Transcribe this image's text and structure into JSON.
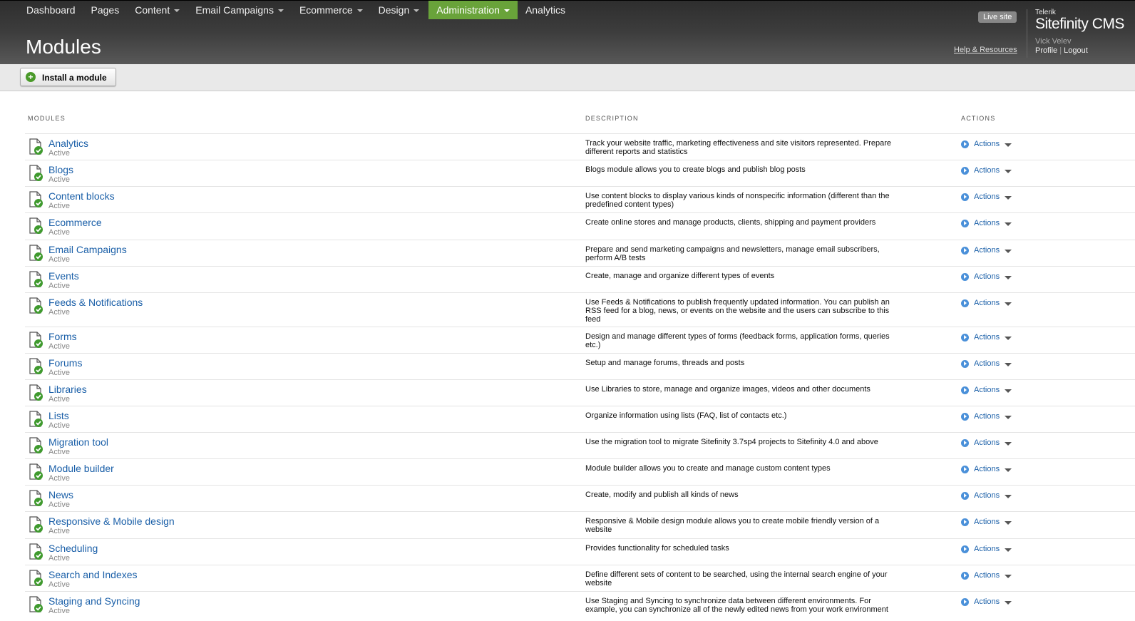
{
  "nav": [
    {
      "label": "Dashboard",
      "dropdown": false,
      "active": false
    },
    {
      "label": "Pages",
      "dropdown": false,
      "active": false
    },
    {
      "label": "Content",
      "dropdown": true,
      "active": false
    },
    {
      "label": "Email Campaigns",
      "dropdown": true,
      "active": false
    },
    {
      "label": "Ecommerce",
      "dropdown": true,
      "active": false
    },
    {
      "label": "Design",
      "dropdown": true,
      "active": false
    },
    {
      "label": "Administration",
      "dropdown": true,
      "active": true
    },
    {
      "label": "Analytics",
      "dropdown": false,
      "active": false
    }
  ],
  "header": {
    "title": "Modules",
    "live_site": "Live site",
    "help": "Help & Resources",
    "brand_small": "Telerik",
    "brand_big": "Sitefinity CMS",
    "user_name": "Vick Velev",
    "profile": "Profile",
    "separator": " | ",
    "logout": "Logout"
  },
  "toolbar": {
    "install_label": "Install a module"
  },
  "table": {
    "headers": {
      "modules": "MODULES",
      "description": "DESCRIPTION",
      "actions": "ACTIONS"
    },
    "rows": [
      {
        "name": "Analytics",
        "status": "Active",
        "description": "Track your website traffic, marketing effectiveness and site visitors represented. Prepare different reports and statistics",
        "action": "Actions"
      },
      {
        "name": "Blogs",
        "status": "Active",
        "description": "Blogs module allows you to create blogs and publish blog posts",
        "action": "Actions"
      },
      {
        "name": "Content blocks",
        "status": "Active",
        "description": "Use content blocks to display various kinds of nonspecific information (different than the predefined content types)",
        "action": "Actions"
      },
      {
        "name": "Ecommerce",
        "status": "Active",
        "description": "Create online stores and manage products, clients, shipping and payment providers",
        "action": "Actions"
      },
      {
        "name": "Email Campaigns",
        "status": "Active",
        "description": "Prepare and send marketing campaigns and newsletters, manage email subscribers, perform A/B tests",
        "action": "Actions"
      },
      {
        "name": "Events",
        "status": "Active",
        "description": "Create, manage and organize different types of events",
        "action": "Actions"
      },
      {
        "name": "Feeds & Notifications",
        "status": "Active",
        "description": "Use Feeds & Notifications to publish frequently updated information. You can publish an RSS feed for a blog, news, or events on the website and the users can subscribe to this feed",
        "action": "Actions"
      },
      {
        "name": "Forms",
        "status": "Active",
        "description": "Design and manage different types of forms (feedback forms, application forms, queries etc.)",
        "action": "Actions"
      },
      {
        "name": "Forums",
        "status": "Active",
        "description": "Setup and manage forums, threads and posts",
        "action": "Actions"
      },
      {
        "name": "Libraries",
        "status": "Active",
        "description": "Use Libraries to store, manage and organize images, videos and other documents",
        "action": "Actions"
      },
      {
        "name": "Lists",
        "status": "Active",
        "description": "Organize information using lists (FAQ, list of contacts etc.)",
        "action": "Actions"
      },
      {
        "name": "Migration tool",
        "status": "Active",
        "description": "Use the migration tool to migrate Sitefinity 3.7sp4 projects to Sitefinity 4.0 and above",
        "action": "Actions"
      },
      {
        "name": "Module builder",
        "status": "Active",
        "description": "Module builder allows you to create and manage custom content types",
        "action": "Actions"
      },
      {
        "name": "News",
        "status": "Active",
        "description": "Create, modify and publish all kinds of news",
        "action": "Actions"
      },
      {
        "name": "Responsive & Mobile design",
        "status": "Active",
        "description": "Responsive & Mobile design module allows you to create mobile friendly version of a website",
        "action": "Actions"
      },
      {
        "name": "Scheduling",
        "status": "Active",
        "description": "Provides functionality for scheduled tasks",
        "action": "Actions"
      },
      {
        "name": "Search and Indexes",
        "status": "Active",
        "description": "Define different sets of content to be searched, using the internal search engine of your website",
        "action": "Actions"
      },
      {
        "name": "Staging and Syncing",
        "status": "Active",
        "description": "Use Staging and Syncing to synchronize data between different environments. For example, you can synchronize all of the newly edited news from your work environment",
        "action": "Actions"
      }
    ]
  }
}
